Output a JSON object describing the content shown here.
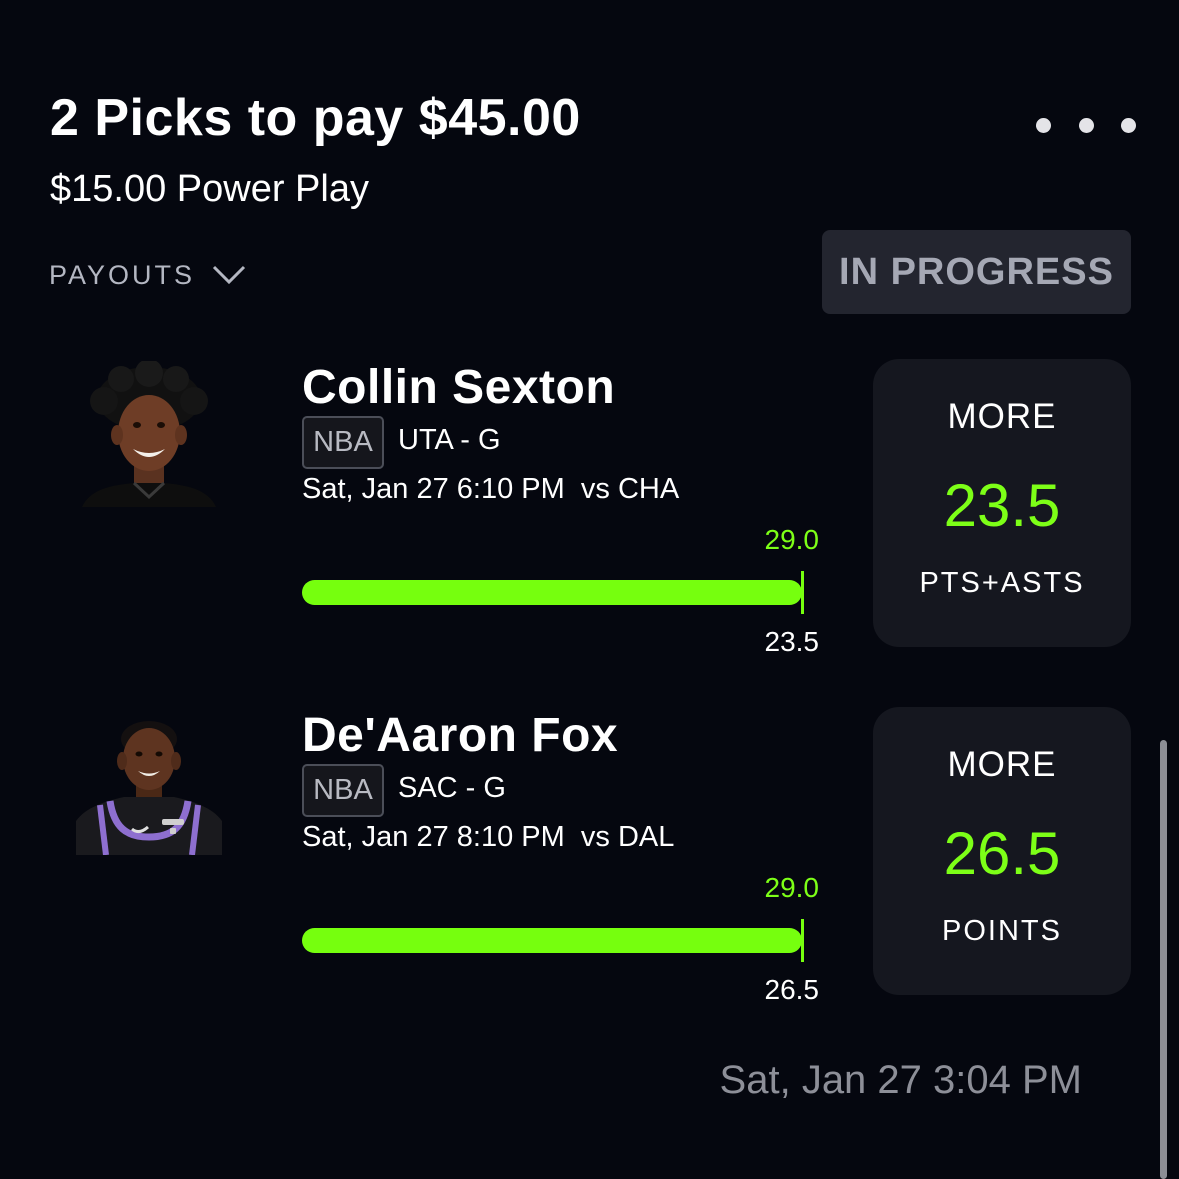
{
  "header": {
    "title": "2 Picks to pay $45.00",
    "subtitle": "$15.00 Power Play",
    "more_icon": "more-horizontal-icon",
    "payouts_label": "PAYOUTS",
    "payouts_icon": "chevron-down-icon",
    "status": "IN PROGRESS"
  },
  "picks": [
    {
      "player": "Collin Sexton",
      "avatar_icon": "player-headshot",
      "league": "NBA",
      "team_position": "UTA - G",
      "game_info": "Sat, Jan 27 6:10 PM  vs CHA",
      "current_value": "29.0",
      "line_value": "23.5",
      "progress_fraction": 1.0,
      "direction": "MORE",
      "line": "23.5",
      "stat": "PTS+ASTS"
    },
    {
      "player": "De'Aaron Fox",
      "avatar_icon": "player-headshot",
      "league": "NBA",
      "team_position": "SAC - G",
      "game_info": "Sat, Jan 27 8:10 PM  vs DAL",
      "current_value": "29.0",
      "line_value": "26.5",
      "progress_fraction": 1.0,
      "direction": "MORE",
      "line": "26.5",
      "stat": "POINTS"
    }
  ],
  "footer": {
    "timestamp": "Sat, Jan 27 3:04 PM"
  },
  "colors": {
    "background": "#05070f",
    "accent_green": "#76ff0e",
    "card": "#15171f",
    "badge": "#23252f"
  }
}
